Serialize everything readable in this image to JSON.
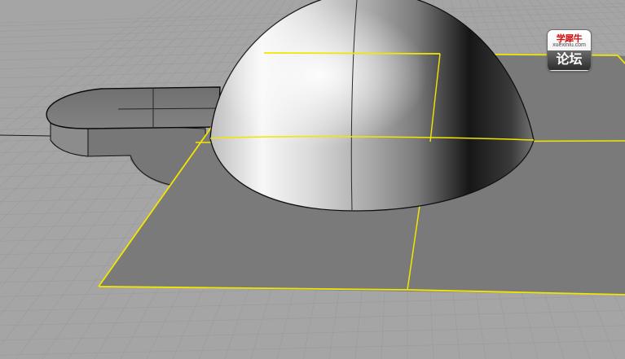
{
  "viewport": {
    "background_color": "#a5a5a5",
    "grid_color": "#9a9a9a",
    "selection_color": "#f2e600",
    "objects": {
      "dome": "shaded hemisphere",
      "plane": "selected planar surface",
      "extrusion": "rounded slot extrusion"
    }
  },
  "watermark": {
    "top_text": "学犀牛",
    "site_text": "xuexiniu.com",
    "bottom_text": "论坛"
  }
}
